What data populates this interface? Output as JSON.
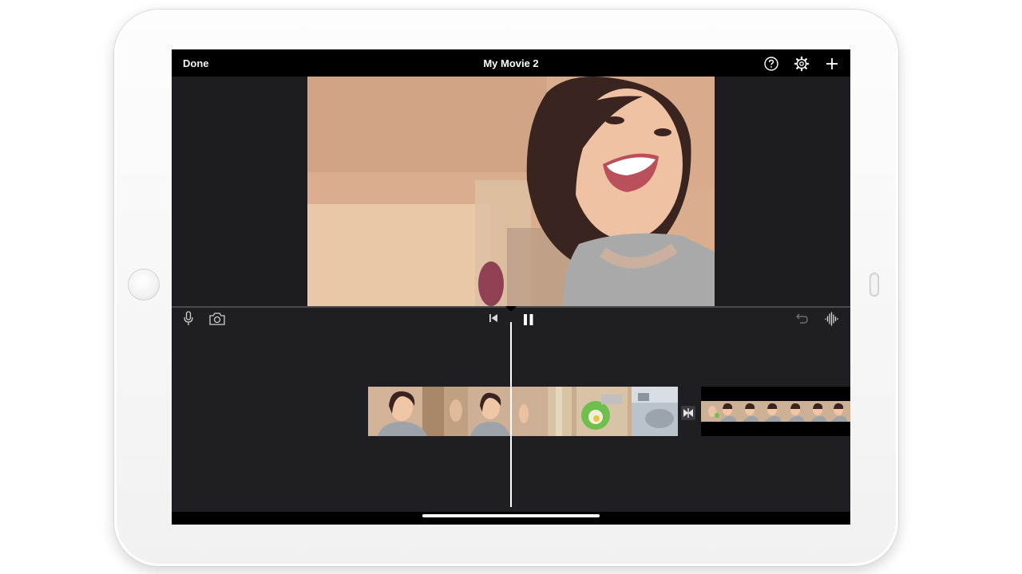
{
  "app": {
    "title": "My Movie 2",
    "done_label": "Done"
  },
  "toolbar": {
    "icons": [
      "help-icon",
      "settings-icon",
      "add-icon"
    ]
  },
  "viewer": {
    "content": "video-preview"
  },
  "timeline_controls": {
    "left_icons": [
      "microphone-icon",
      "camera-icon"
    ],
    "center_icons": [
      "skip-to-start-icon",
      "pause-icon"
    ],
    "right_icons": [
      "undo-icon",
      "audio-waveform-icon"
    ]
  },
  "timeline": {
    "clips": [
      "clip-1",
      "clip-2",
      "clip-3"
    ],
    "transition_icon": "transition-icon"
  },
  "colors": {
    "screen_bg": "#000000",
    "timeline_bg": "#1f1e23",
    "playhead": "#ffffff",
    "frame": "#f4f4f4"
  }
}
